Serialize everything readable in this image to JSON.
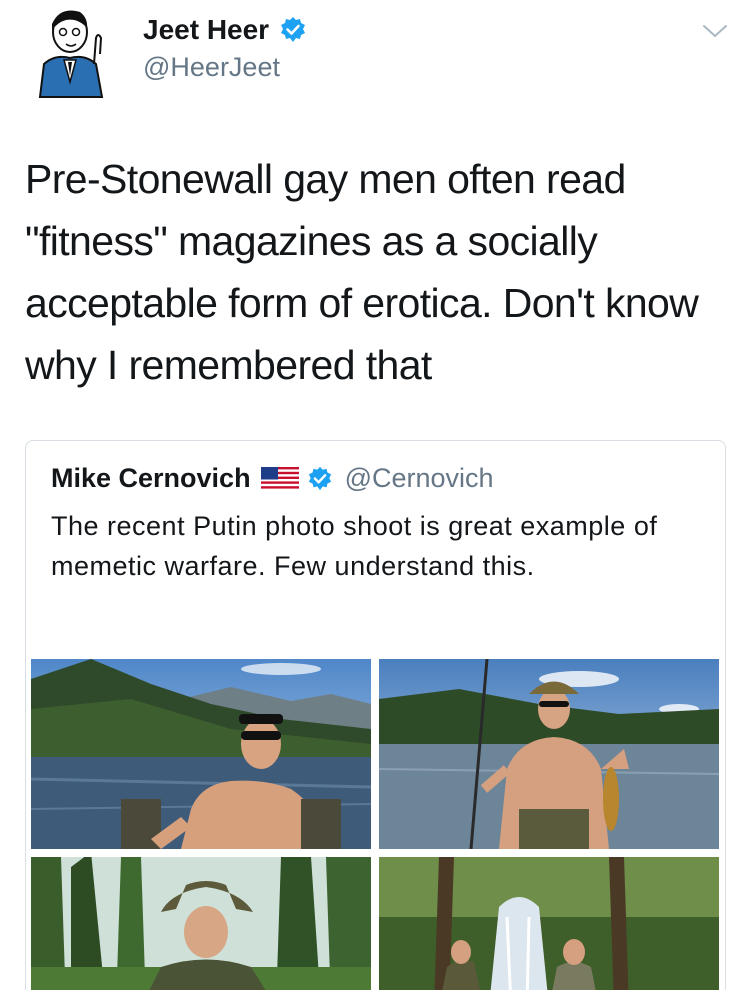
{
  "tweet": {
    "author": {
      "display_name": "Jeet Heer",
      "handle": "@HeerJeet",
      "verified": true
    },
    "text": "Pre-Stonewall gay men often read \"fitness\" magazines as a socially acceptable form of erotica. Don't know why I remembered that",
    "menu_icon": "chevron-down-icon"
  },
  "quoted_tweet": {
    "author": {
      "display_name": "Mike Cernovich",
      "handle": "@Cernovich",
      "flag": "us-flag-icon",
      "verified": true
    },
    "text": "The recent Putin photo shoot is great example of memetic warfare. Few understand this.",
    "photos": [
      {
        "subject": "man-sunglasses-lake"
      },
      {
        "subject": "man-fishing-lake"
      },
      {
        "subject": "man-hat-forest"
      },
      {
        "subject": "two-men-waterfall"
      }
    ]
  },
  "colors": {
    "text": "#14171a",
    "secondary": "#657786",
    "verified": "#1da1f2",
    "border": "#d8dee3"
  }
}
